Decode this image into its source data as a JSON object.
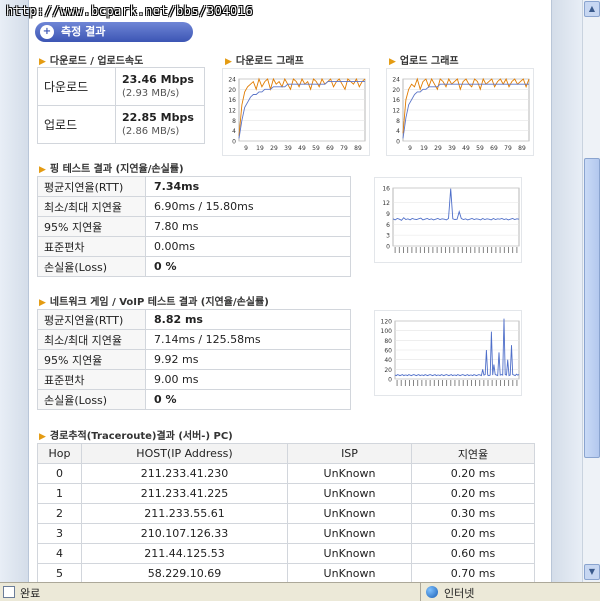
{
  "watermark": "http://www.bcpark.net/bbs/304016",
  "result_tab": {
    "label": "측정 결과",
    "icon": "plus-circle-icon"
  },
  "speed": {
    "section_title": "다운로드 / 업로드속도",
    "rows": [
      {
        "label": "다운로드",
        "main": "23.46 Mbps",
        "sub": "(2.93 MB/s)"
      },
      {
        "label": "업로드",
        "main": "22.85 Mbps",
        "sub": "(2.86 MB/s)"
      }
    ]
  },
  "download_graph": {
    "title": "다운로드 그래프",
    "chart_data": {
      "type": "line",
      "ylim": [
        0,
        24
      ],
      "yticks": [
        0,
        4,
        8,
        12,
        16,
        20,
        24
      ],
      "xticks": [
        "9",
        "19",
        "29",
        "39",
        "49",
        "59",
        "69",
        "79",
        "89"
      ],
      "series": [
        {
          "color": "#e07b00",
          "values": [
            2,
            14,
            19,
            21,
            22,
            23,
            20,
            24,
            21,
            23,
            24,
            20,
            24,
            22,
            23,
            21,
            24,
            22,
            20,
            24,
            23,
            21,
            24,
            22,
            23,
            20,
            24,
            23,
            21,
            24,
            22,
            23,
            24,
            21,
            23,
            24,
            22,
            20,
            24,
            23,
            22,
            24,
            21,
            23,
            24
          ]
        },
        {
          "color": "#5a74c7",
          "values": [
            1,
            8,
            13,
            15,
            17,
            18,
            18,
            19,
            19,
            20,
            20,
            20,
            21,
            21,
            21,
            21,
            21,
            22,
            22,
            22,
            22,
            22,
            22,
            22,
            22,
            22,
            22,
            22,
            22,
            22,
            22,
            23,
            23,
            23,
            23,
            23,
            23,
            23,
            23,
            23,
            23,
            23,
            23,
            23,
            23
          ]
        }
      ]
    }
  },
  "upload_graph": {
    "title": "업로드 그래프",
    "chart_data": {
      "type": "line",
      "ylim": [
        0,
        24
      ],
      "yticks": [
        0,
        4,
        8,
        12,
        16,
        20,
        24
      ],
      "xticks": [
        "9",
        "19",
        "29",
        "39",
        "49",
        "59",
        "69",
        "79",
        "89"
      ],
      "series": [
        {
          "color": "#e07b00",
          "values": [
            3,
            16,
            20,
            22,
            21,
            24,
            20,
            23,
            24,
            21,
            24,
            22,
            20,
            24,
            23,
            21,
            24,
            22,
            23,
            24,
            20,
            23,
            24,
            22,
            21,
            24,
            23,
            20,
            24,
            22,
            23,
            24,
            21,
            23,
            24,
            22,
            24,
            21,
            23,
            24,
            22,
            23,
            24,
            21,
            24
          ]
        },
        {
          "color": "#5a74c7",
          "values": [
            1,
            9,
            14,
            16,
            18,
            19,
            19,
            20,
            20,
            21,
            21,
            21,
            21,
            22,
            22,
            22,
            22,
            22,
            22,
            22,
            22,
            22,
            22,
            22,
            22,
            22,
            22,
            22,
            22,
            22,
            22,
            22,
            22,
            22,
            22,
            22,
            22,
            22,
            22,
            22,
            22,
            22,
            22,
            22,
            22
          ]
        }
      ]
    }
  },
  "ping": {
    "section_title": "핑 테스트 결과 (지연율/손실률)",
    "rows": [
      {
        "label": "평균지연율(RTT)",
        "value": "7.34ms",
        "bold": true
      },
      {
        "label": "최소/최대 지연율",
        "value": "6.90ms / 15.80ms",
        "bold": false
      },
      {
        "label": "95% 지연율",
        "value": "7.80 ms",
        "bold": false
      },
      {
        "label": "표준편차",
        "value": "0.00ms",
        "bold": false
      },
      {
        "label": "손실율(Loss)",
        "value": "0 %",
        "bold": true
      }
    ],
    "chart_data": {
      "type": "line",
      "ylim": [
        0,
        16
      ],
      "yticks": [
        0,
        3,
        6,
        9,
        12,
        16
      ],
      "series": [
        {
          "color": "#4f6fc9",
          "values": [
            7.5,
            7.2,
            7.6,
            7.4,
            7.1,
            7.8,
            7.3,
            7.5,
            7.2,
            7.6,
            7.4,
            7.3,
            7.5,
            7.7,
            7.2,
            7.4,
            7.6,
            7.3,
            7.5,
            7.2,
            7.4,
            7.6,
            7.3,
            7.5,
            7.4,
            7.2,
            7.6,
            15.8,
            7.5,
            7.3,
            7.4,
            9.5,
            7.6,
            7.3,
            7.5,
            7.2,
            7.4,
            7.6,
            7.3,
            7.5,
            7.4,
            7.2,
            7.6,
            7.3,
            7.5,
            7.4,
            7.2,
            7.6,
            7.3,
            7.5,
            7.4,
            7.6,
            7.3,
            7.5,
            7.2,
            7.4,
            7.6,
            7.3,
            7.5,
            7.4
          ]
        }
      ]
    }
  },
  "game": {
    "section_title": "네트워크 게임 / VoIP 테스트 결과 (지연율/손실률)",
    "rows": [
      {
        "label": "평균지연율(RTT)",
        "value": "8.82 ms",
        "bold": true
      },
      {
        "label": "최소/최대 지연율",
        "value": "7.14ms / 125.58ms",
        "bold": false
      },
      {
        "label": "95% 지연율",
        "value": "9.92 ms",
        "bold": false
      },
      {
        "label": "표준편차",
        "value": "9.00 ms",
        "bold": false
      },
      {
        "label": "손실율(Loss)",
        "value": "0 %",
        "bold": true
      }
    ],
    "chart_data": {
      "type": "line",
      "ylim": [
        0,
        120
      ],
      "yticks": [
        0,
        20,
        40,
        60,
        80,
        100,
        120
      ],
      "series": [
        {
          "color": "#4f6fc9",
          "values": [
            8,
            7,
            9,
            8,
            7,
            8,
            9,
            7,
            8,
            8,
            7,
            9,
            8,
            7,
            8,
            9,
            8,
            7,
            8,
            9,
            7,
            8,
            8,
            7,
            9,
            8,
            7,
            8,
            9,
            8,
            7,
            8,
            9,
            7,
            8,
            8,
            7,
            9,
            8,
            7,
            8,
            9,
            8,
            7,
            8,
            9,
            7,
            8,
            8,
            7,
            9,
            8,
            7,
            8,
            9,
            8,
            7,
            8,
            9,
            7,
            8,
            8,
            7,
            9,
            8,
            7,
            8,
            9,
            8,
            7,
            20,
            8,
            9,
            60,
            8,
            7,
            8,
            98,
            8,
            30,
            9,
            8,
            7,
            55,
            8,
            9,
            8,
            125,
            9,
            8,
            40,
            7,
            8,
            70,
            9,
            8,
            7,
            10,
            8,
            9
          ]
        }
      ]
    }
  },
  "traceroute": {
    "section_title": "경로추적(Traceroute)결과 (서버-) PC)",
    "headers": [
      "Hop",
      "HOST(IP Address)",
      "ISP",
      "지연율"
    ],
    "rows": [
      [
        "0",
        "211.233.41.230",
        "UnKnown",
        "0.20 ms"
      ],
      [
        "1",
        "211.233.41.225",
        "UnKnown",
        "0.20 ms"
      ],
      [
        "2",
        "211.233.55.61",
        "UnKnown",
        "0.30 ms"
      ],
      [
        "3",
        "210.107.126.33",
        "UnKnown",
        "0.20 ms"
      ],
      [
        "4",
        "211.44.125.53",
        "UnKnown",
        "0.60 ms"
      ],
      [
        "5",
        "58.229.10.69",
        "UnKnown",
        "0.70 ms"
      ]
    ]
  },
  "statusbar": {
    "left_text": "완료",
    "zone_text": "인터넷",
    "left_icon": "page-done-icon",
    "zone_icon": "globe-icon"
  },
  "scrollbar": {
    "up_icon": "arrow-up-icon",
    "down_icon": "arrow-down-icon"
  }
}
